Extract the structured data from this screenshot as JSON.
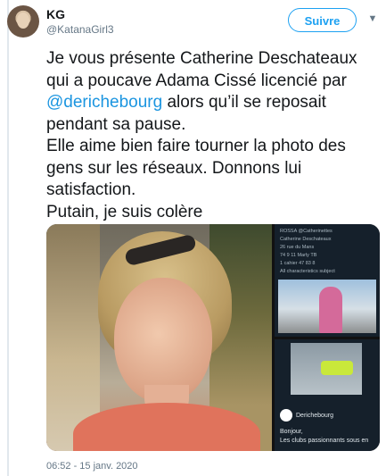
{
  "author": {
    "name": "KG",
    "handle": "@KatanaGirl3"
  },
  "follow_button": {
    "label": "Suivre"
  },
  "tweet": {
    "lines": [
      "Je vous présente Catherine Deschateaux",
      "qui a poucave Adama Cissé licencié par"
    ],
    "mention": "@derichebourg",
    "mention_rest": " alors qu’il se reposait",
    "lines_after": [
      "pendant sa pause.",
      "Elle aime bien faire tourner la photo des",
      "gens sur les réseaux. Donnons lui",
      "satisfaction.",
      "Putain, je suis colère"
    ]
  },
  "media": {
    "shot1_lines": [
      "ROSSA @Catherinettes",
      "Catherine Deschateaux",
      "26 rue du Mans",
      "74 9 11 Marly TB",
      "1 cahier 47 83 8",
      "All characteristics subject"
    ],
    "shot2_lines": [
      "Derichebourg",
      "Bonjour,",
      "Les clubs passionnants sous en"
    ]
  },
  "timestamp": "06:52 - 15 janv. 2020",
  "colors": {
    "accent": "#1da1f2",
    "mention": "#1b95e0",
    "text": "#14171a",
    "muted": "#657786"
  }
}
